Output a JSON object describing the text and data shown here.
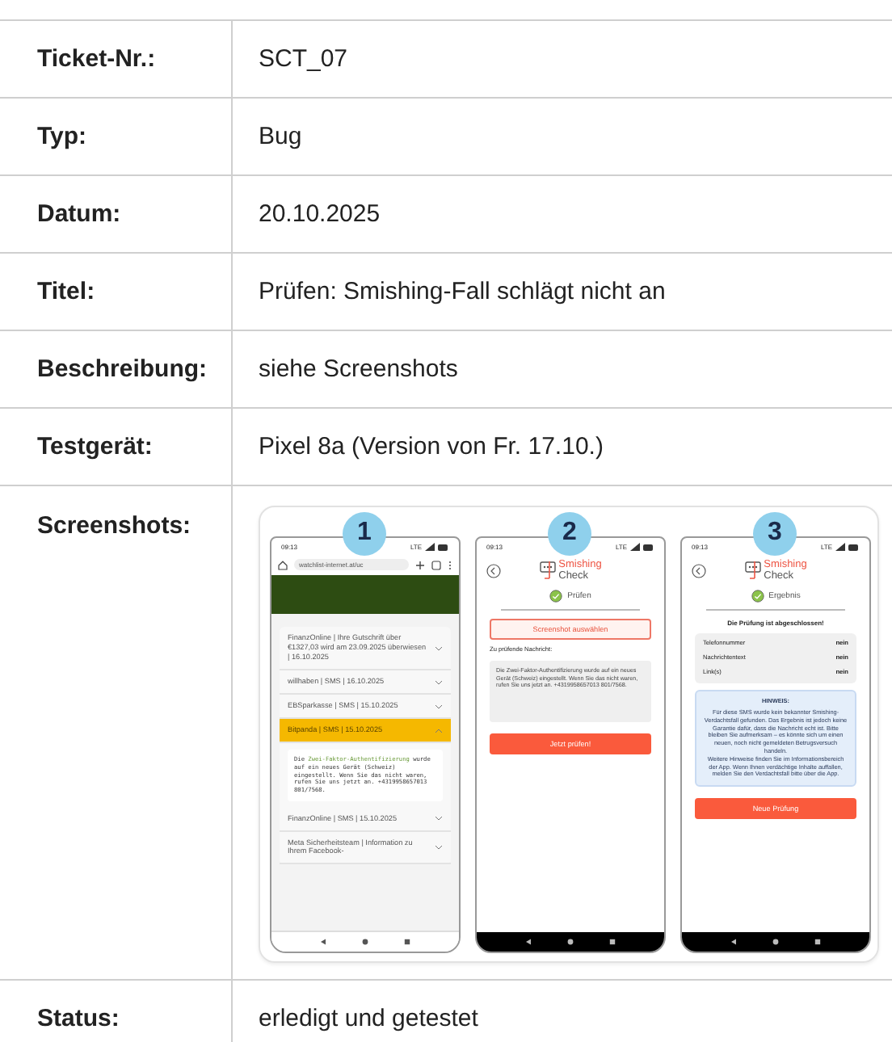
{
  "rows": [
    {
      "kind": "text",
      "label": "Ticket-Nr.:",
      "value": "SCT_07"
    },
    {
      "kind": "text",
      "label": "Typ:",
      "value": "Bug"
    },
    {
      "kind": "text",
      "label": "Datum:",
      "value": "20.10.2025"
    },
    {
      "kind": "text",
      "label": "Titel:",
      "value": "Prüfen: Smishing-Fall schlägt nicht an"
    },
    {
      "kind": "text",
      "label": "Beschreibung:",
      "value": "siehe Screenshots"
    },
    {
      "kind": "text",
      "label": "Testgerät:",
      "value": "Pixel 8a (Version von Fr. 17.10.)"
    },
    {
      "kind": "screenshots",
      "label": "Screenshots:",
      "screenshots": [
        {
          "kind": "browser",
          "badge": "1",
          "time": "09:13",
          "network": "LTE",
          "url": "watchlist-internet.at/uc",
          "items": [
            {
              "title": "FinanzOnline | Ihre Gutschrift über €1327,03 wird am 23.09.2025 überwiesen | 16.10.2025",
              "expanded": false
            },
            {
              "title": "willhaben | SMS | 16.10.2025",
              "expanded": false
            },
            {
              "title": "EBSparkasse | SMS | 15.10.2025",
              "expanded": false
            },
            {
              "title": "Bitpanda | SMS | 15.10.2025",
              "expanded": true,
              "message_parts": [
                {
                  "text": "Die ",
                  "highlight": false
                },
                {
                  "text": "Zwei-Faktor-Authentifizierung",
                  "highlight": true
                },
                {
                  "text": " wurde auf ein neues Gerät (Schweiz) eingestellt. Wenn Sie das nicht waren, rufen Sie uns jetzt an. +4319958657013 801/7568.",
                  "highlight": false
                }
              ]
            },
            {
              "title": "FinanzOnline | SMS | 15.10.2025",
              "expanded": false
            },
            {
              "title": "Meta Sicherheitsteam | Information zu Ihrem Facebook-",
              "expanded": false
            }
          ]
        },
        {
          "kind": "check_input",
          "badge": "2",
          "time": "09:13",
          "network": "LTE",
          "logo_top": "Smishing",
          "logo_bottom": "Check",
          "step": "Prüfen",
          "select_button": "Screenshot auswählen",
          "message_label": "Zu prüfende Nachricht:",
          "message": "Die Zwei-Faktor-Authentifizierung wurde auf ein neues Gerät (Schweiz) eingestellt. Wenn Sie das nicht waren, rufen Sie uns jetzt an. +4319958657013 801/7568.",
          "submit_button": "Jetzt prüfen!"
        },
        {
          "kind": "check_result",
          "badge": "3",
          "time": "09:13",
          "network": "LTE",
          "logo_top": "Smishing",
          "logo_bottom": "Check",
          "step": "Ergebnis",
          "summary": "Die Prüfung ist abgeschlossen!",
          "results": [
            {
              "label": "Telefonnummer",
              "value": "nein"
            },
            {
              "label": "Nachrichtentext",
              "value": "nein"
            },
            {
              "label": "Link(s)",
              "value": "nein"
            }
          ],
          "hint_title": "HINWEIS:",
          "hint_text": "Für diese SMS wurde kein bekannter Smishing-Verdachtsfall gefunden. Das Ergebnis ist jedoch keine Garantie dafür, dass die Nachricht echt ist. Bitte bleiben Sie aufmerksam – es könnte sich um einen neuen, noch nicht gemeldeten Betrugsversuch handeln.",
          "hint_text_2": "Weitere Hinweise finden Sie im Informationsbereich der App. Wenn Ihnen verdächtige Inhalte auffallen, melden Sie den Verdachtsfall bitte über die App.",
          "new_button": "Neue Prüfung"
        }
      ]
    },
    {
      "kind": "text",
      "label": "Status:",
      "value": "erledigt und getestet"
    }
  ]
}
